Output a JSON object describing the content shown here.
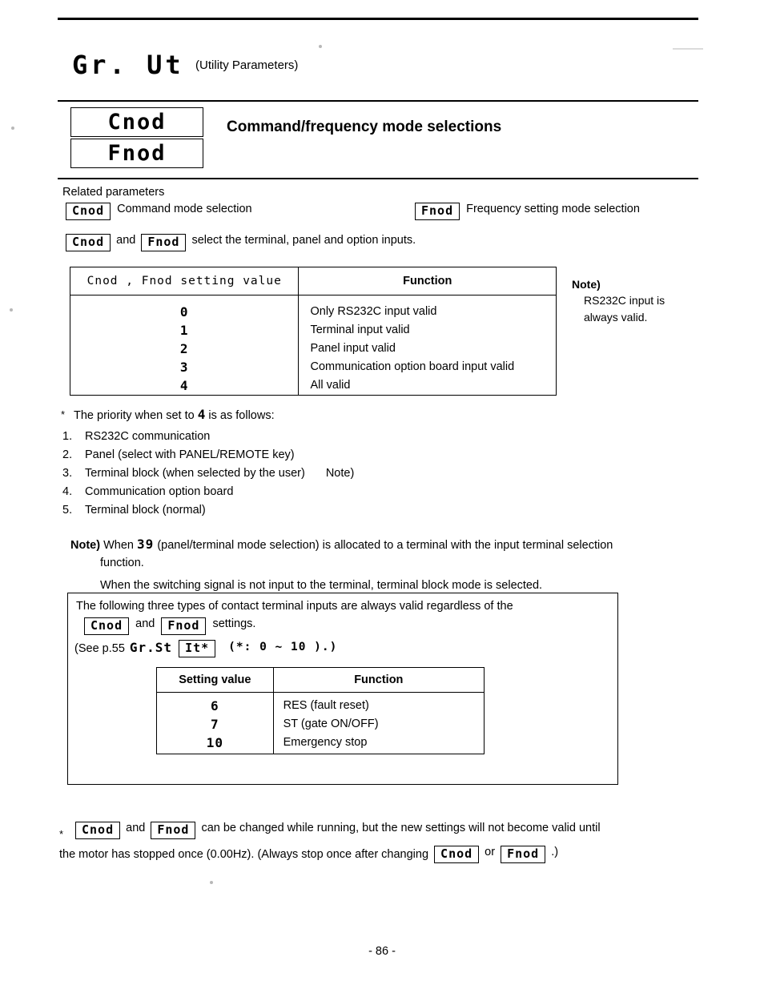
{
  "header": {
    "group_code": "Gr. Ut",
    "group_label": "(Utility Parameters)",
    "code_1": "Cnod",
    "code_2": "Fnod",
    "title": "Command/frequency mode selections"
  },
  "related": {
    "heading": "Related parameters",
    "param_1_code": "Cnod",
    "param_1_label": "Command mode selection",
    "param_2_code": "Fnod",
    "param_2_label": "Frequency setting mode selection",
    "sentence_code_1": "Cnod",
    "sentence_and": "and",
    "sentence_code_2": "Fnod",
    "sentence_tail": "select the terminal, panel and option inputs."
  },
  "table_main": {
    "header_setting": "Cnod , Fnod setting value",
    "header_function": "Function",
    "values": [
      "0",
      "1",
      "2",
      "3",
      "4"
    ],
    "functions": [
      "Only RS232C input valid",
      "Terminal input valid",
      "Panel input valid",
      "Communication option board input valid",
      "All valid"
    ]
  },
  "side_note": {
    "label": "Note)",
    "line1": "RS232C input is",
    "line2": "always valid."
  },
  "priority": {
    "star": "*",
    "lead_before": "The priority when set to",
    "lead_value": "4",
    "lead_after": "is as follows:",
    "items": [
      {
        "num": "1.",
        "text": "RS232C communication",
        "note": ""
      },
      {
        "num": "2.",
        "text": "Panel (select with PANEL/REMOTE key)",
        "note": ""
      },
      {
        "num": "3.",
        "text": "Terminal block (when selected by the user)",
        "note": "Note)"
      },
      {
        "num": "4.",
        "text": "Communication option board",
        "note": ""
      },
      {
        "num": "5.",
        "text": "Terminal block (normal)",
        "note": ""
      }
    ]
  },
  "note_block": {
    "label": "Note)",
    "word_when": "When",
    "value": "39",
    "line1_tail": "(panel/terminal mode selection) is allocated to a terminal with the input terminal selection",
    "line2": "function.",
    "line3": "When the switching signal is not input to the terminal, terminal block mode is selected."
  },
  "big_box": {
    "line1": "The following three types of contact terminal inputs are always valid regardless of the",
    "code_1": "Cnod",
    "and": "and",
    "code_2": "Fnod",
    "line2_tail": "settings.",
    "see_text": "(See p.55",
    "see_code": "Gr.St",
    "see_code_2": "It*",
    "see_paren": "(*:  0  ~ 10 ).)",
    "table": {
      "header_setting": "Setting value",
      "header_function": "Function",
      "values": [
        "6",
        "7",
        "10"
      ],
      "functions": [
        "RES (fault reset)",
        "ST (gate ON/OFF)",
        "Emergency stop"
      ]
    }
  },
  "bottom": {
    "star": "*",
    "code_1": "Cnod",
    "and": "and",
    "code_2": "Fnod",
    "text_1": "can be changed while running, but the new settings will not become valid until",
    "text_2a": "the motor has stopped once (0.00Hz). (Always stop once after changing",
    "code_3": "Cnod",
    "or": "or",
    "code_4": "Fnod",
    "text_2b": ".)"
  },
  "page_number": "- 86 -"
}
